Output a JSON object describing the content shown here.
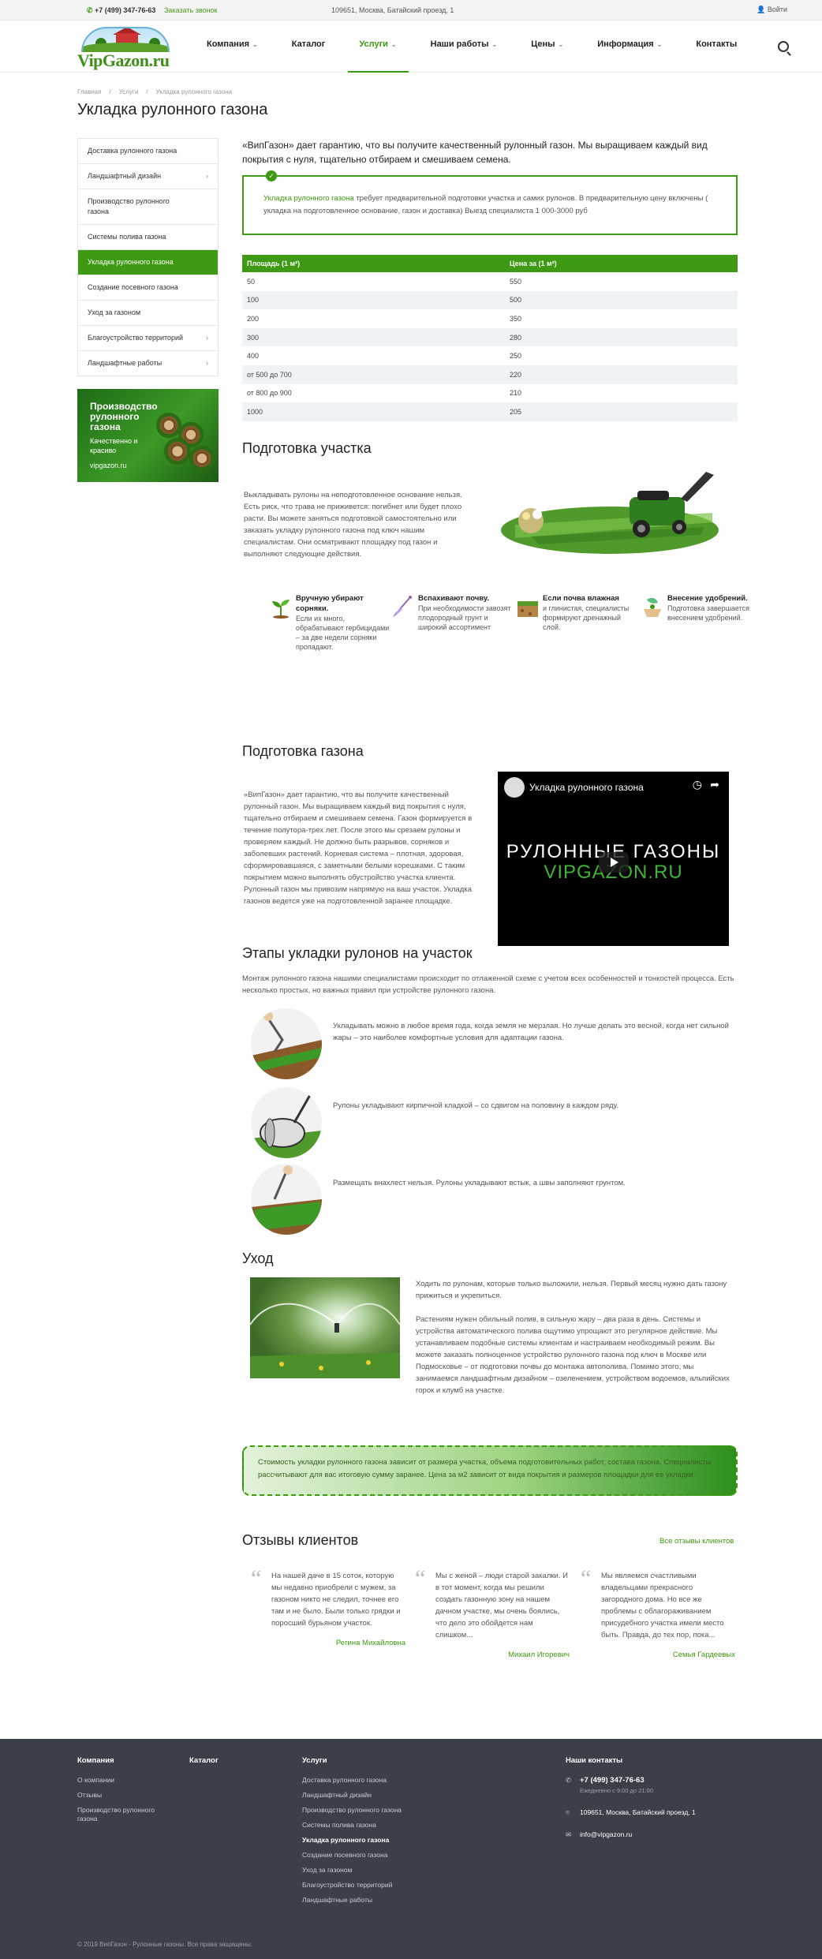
{
  "topbar": {
    "phone": "+7 (499) 347-76-63",
    "callback": "Заказать звонок",
    "address": "109651, Москва, Батайский проезд, 1",
    "login": "Войти"
  },
  "brand": {
    "logo_text": "VipGazon.ru",
    "accent": "#3d9a12"
  },
  "nav": [
    {
      "label": "Компания",
      "chev": "⌄"
    },
    {
      "label": "Каталог",
      "chev": ""
    },
    {
      "label": "Услуги",
      "chev": "⌄"
    },
    {
      "label": "Наши работы",
      "chev": "⌄"
    },
    {
      "label": "Цены",
      "chev": "⌄"
    },
    {
      "label": "Информация",
      "chev": "⌄"
    },
    {
      "label": "Контакты",
      "chev": ""
    }
  ],
  "breadcrumbs": [
    "Главная",
    "/",
    "Услуги",
    "/",
    "Укладка рулонного газона"
  ],
  "page_title": "Укладка рулонного газона",
  "sidebar": [
    {
      "label": "Доставка рулонного газона",
      "arrow": ""
    },
    {
      "label": "Ландшафтный дизайн",
      "arrow": "›"
    },
    {
      "label": "Производство рулонного газона",
      "arrow": ""
    },
    {
      "label": "Системы полива газона",
      "arrow": ""
    },
    {
      "label": "Укладка рулонного газона",
      "arrow": ""
    },
    {
      "label": "Создание посевного газона",
      "arrow": ""
    },
    {
      "label": "Уход за газоном",
      "arrow": ""
    },
    {
      "label": "Благоустройство территорий",
      "arrow": "›"
    },
    {
      "label": "Ландшафтные работы",
      "arrow": "›"
    }
  ],
  "promo": {
    "title": "Производство рулонного газона",
    "subtitle": "Качественно и красиво",
    "url": "vipgazon.ru"
  },
  "intro": "«ВипГазон» дает гарантию, что вы получите качественный рулонный газон. Мы выращиваем каждый вид покрытия с нуля, тщательно отбираем и смешиваем семена.",
  "note": {
    "badge": "✓",
    "highlight": "Укладка рулонного газона",
    "text": " требует предварительной подготовки участка и самих рулонов. В предварительную цену включены ( укладка на подготовленное основание, газон и доставка) Выезд специалиста 1 000-3000 руб"
  },
  "price_table": {
    "headers": [
      "Площадь (1 м²)",
      "Цена за (1 м²)"
    ],
    "rows": [
      [
        "50",
        "550"
      ],
      [
        "100",
        "500"
      ],
      [
        "200",
        "350"
      ],
      [
        "300",
        "280"
      ],
      [
        "400",
        "250"
      ],
      [
        "от 500 до 700",
        "220"
      ],
      [
        "от 800 до 900",
        "210"
      ],
      [
        "1000",
        "205"
      ]
    ]
  },
  "prep": {
    "title": "Подготовка участка",
    "text": "Выкладывать рулоны на неподготовленное основание нельзя. Есть риск, что трава не приживется: погибнет или будет плохо расти. Вы можете заняться подготовкой самостоятельно или заказать укладку рулонного газона под ключ нашим специалистам. Они осматривают площадку под газон и выполняют следующие действия."
  },
  "features": [
    {
      "title": "Вручную убирают сорняки.",
      "text": "Если их много, обрабатывают гербицидами – за две недели сорняки пропадают.",
      "icon": "sprout-icon"
    },
    {
      "title": "Вспахивают почву.",
      "text": "При необходимости завозят плодородный грунт и широкий ассортимент",
      "icon": "shovel-icon"
    },
    {
      "title": "Если почва влажная",
      "text": "и глинистая, специалисты формируют дренажный слой.",
      "icon": "soil-icon"
    },
    {
      "title": "Внесение удобрений.",
      "text": "Подготовка завершается внесением удобрений.",
      "icon": "fertilizer-icon"
    }
  ],
  "lawn_prep": {
    "title": "Подготовка газона",
    "text": "«ВипГазон» дает гарантию, что вы получите качественный рулонный газон. Мы выращиваем каждый вид покрытия с нуля, тщательно отбираем и смешиваем семена. Газон формируется в течение полутора-трех лет. После этого мы срезаем рулоны и проверяем каждый. Не должно быть разрывов, сорняков и заболевших растений. Корневая система – плотная, здоровая, сформировавшаяся, с заметными белыми корешками. С таким покрытием можно выполнять обустройство участка клиента. Рулонный газон мы привозим напрямую на ваш участок. Укладка газонов ведется уже на подготовленной заранее площадке."
  },
  "video": {
    "title": "Укладка рулонного газона",
    "line1": "РУЛОННЫЕ ГАЗОНЫ",
    "line2": "VIPGAZON.RU"
  },
  "stages": {
    "title": "Этапы укладки рулонов на участок",
    "text": "Монтаж рулонного газона нашими специалистами происходит по отлаженной схеме с учетом всех особенностей и тонкостей процесса. Есть несколько простых, но важных правил при устройстве рулонного газона.",
    "items": [
      "Укладывать можно в любое время года, когда земля не мерзлая. Но лучше делать это весной, когда нет сильной жары – это наиболее комфортные условия для адаптации газона.",
      "Рулоны укладывают кирпичной кладкой – со сдвигом на половину в каждом ряду.",
      "Размещать внахлест нельзя. Рулоны укладывают встык, а швы заполняют грунтом."
    ]
  },
  "care": {
    "title": "Уход",
    "p1": "Ходить по рулонам, которые только выложили, нельзя. Первый месяц нужно дать газону прижиться и укрепиться.",
    "p2": "Растениям нужен обильный полив, в сильную жару – два раза в день. Системы и устройства автоматического полива ощутимо упрощают это регулярное действие. Мы устанавливаем подобные системы клиентам и настраиваем необходимый режим. Вы можете заказать полноценное устройство рулонного газона под ключ в Москве или Подмосковье – от подготовки почвы до монтажа автополива. Помимо этого, мы занимаемся ландшафтным дизайном – озеленением, устройством водоемов, альпийских горок и клумб на участке."
  },
  "banner": "Стоимость укладки рулонного газона зависит от размера участка, объема подготовительных работ, состава газона. Специалисты рассчитывают для вас итоговую сумму заранее. Цена за м2 зависит от вида покрытия и размеров площадки для ее укладки.",
  "reviews": {
    "title": "Отзывы клиентов",
    "all_link": "Все отзывы клиентов",
    "items": [
      {
        "text": "На нашей даче в 15 соток, которую мы недавно приобрели с мужем, за газоном никто не следил, точнее его там и не было. Были только грядки и поросший бурьяном участок.",
        "author": "Регина Михайловна"
      },
      {
        "text": "Мы с женой – люди старой закалки. И в тот момент, когда мы решили создать газонную зону на нашем дачном участке, мы очень боялись, что дело это обойдется нам слишком...",
        "author": "Михаил Игоревич"
      },
      {
        "text": "Мы являемся счастливыми владельцами прекрасного загородного дома. Но все же проблемы с облагораживанием присудебного участка имели место быть. Правда, до тех пор, пока...",
        "author": "Семья Гардеевых"
      }
    ]
  },
  "footer": {
    "col1": {
      "title": "Компания",
      "links": [
        "О компании",
        "Отзывы",
        "Производство рулонного газона"
      ]
    },
    "col2": {
      "title": "Каталог"
    },
    "col3": {
      "title": "Услуги",
      "links": [
        "Доставка рулонного газона",
        "Ландшафтный дизайн",
        "Производство рулонного газона",
        "Системы полива газона",
        "Укладка рулонного газона",
        "Создание посевного газона",
        "Уход за газоном",
        "Благоустройство территорий",
        "Ландшафтные работы"
      ]
    },
    "contacts": {
      "title": "Наши контакты",
      "phone": "+7 (499) 347-76-63",
      "hours": "Ежедневно с 9:00 до 21:00",
      "address": "109651, Москва, Батайский проезд, 1",
      "email": "info@vipgazon.ru"
    },
    "copyright": "© 2019 ВипГазон - Рулонные газоны. Все права защищены."
  }
}
